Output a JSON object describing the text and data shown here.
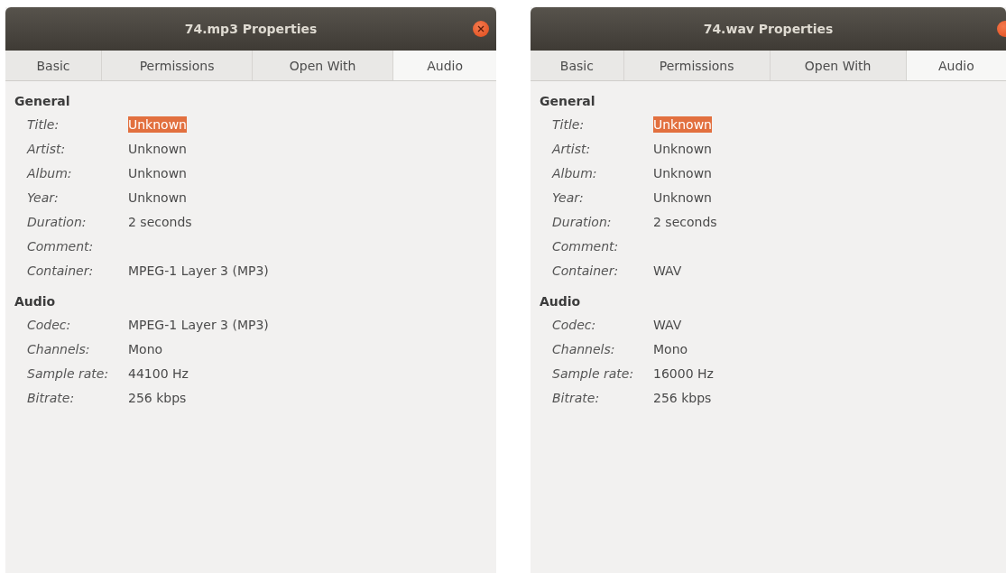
{
  "windows": [
    {
      "title": "74.mp3 Properties",
      "tabs": [
        {
          "label": "Basic",
          "selected": false
        },
        {
          "label": "Permissions",
          "selected": false
        },
        {
          "label": "Open With",
          "selected": false
        },
        {
          "label": "Audio",
          "selected": true
        }
      ],
      "sections": [
        {
          "heading": "General",
          "fields": [
            {
              "label": "Title:",
              "value": "Unknown",
              "selected": true
            },
            {
              "label": "Artist:",
              "value": "Unknown",
              "selected": false
            },
            {
              "label": "Album:",
              "value": "Unknown",
              "selected": false
            },
            {
              "label": "Year:",
              "value": "Unknown",
              "selected": false
            },
            {
              "label": "Duration:",
              "value": "2 seconds",
              "selected": false
            },
            {
              "label": "Comment:"
            },
            {
              "label": "Container:",
              "value": "MPEG-1 Layer 3 (MP3)",
              "selected": false
            }
          ]
        },
        {
          "heading": "Audio",
          "fields": [
            {
              "label": "Codec:",
              "value": "MPEG-1 Layer 3 (MP3)",
              "selected": false
            },
            {
              "label": "Channels:",
              "value": "Mono",
              "selected": false
            },
            {
              "label": "Sample rate:",
              "value": "44100 Hz",
              "selected": false
            },
            {
              "label": "Bitrate:",
              "value": "256 kbps",
              "selected": false
            }
          ]
        }
      ]
    },
    {
      "title": "74.wav Properties",
      "tabs": [
        {
          "label": "Basic",
          "selected": false
        },
        {
          "label": "Permissions",
          "selected": false
        },
        {
          "label": "Open With",
          "selected": false
        },
        {
          "label": "Audio",
          "selected": true
        }
      ],
      "sections": [
        {
          "heading": "General",
          "fields": [
            {
              "label": "Title:",
              "value": "Unknown",
              "selected": true
            },
            {
              "label": "Artist:",
              "value": "Unknown",
              "selected": false
            },
            {
              "label": "Album:",
              "value": "Unknown",
              "selected": false
            },
            {
              "label": "Year:",
              "value": "Unknown",
              "selected": false
            },
            {
              "label": "Duration:",
              "value": "2 seconds",
              "selected": false
            },
            {
              "label": "Comment:"
            },
            {
              "label": "Container:",
              "value": "WAV",
              "selected": false
            }
          ]
        },
        {
          "heading": "Audio",
          "fields": [
            {
              "label": "Codec:",
              "value": "WAV",
              "selected": false
            },
            {
              "label": "Channels:",
              "value": "Mono",
              "selected": false
            },
            {
              "label": "Sample rate:",
              "value": "16000 Hz",
              "selected": false
            },
            {
              "label": "Bitrate:",
              "value": "256 kbps",
              "selected": false
            }
          ]
        }
      ]
    }
  ]
}
